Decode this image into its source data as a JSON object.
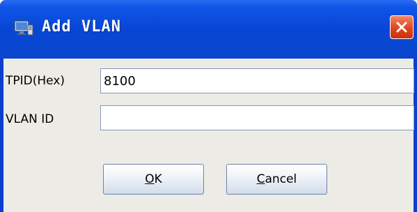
{
  "window": {
    "title": "Add VLAN",
    "icon": "computer-window-icon",
    "close_icon": "close-icon"
  },
  "form": {
    "tpid_label": "TPID(Hex)",
    "tpid_value": "8100",
    "vlan_id_label": "VLAN ID",
    "vlan_id_value": ""
  },
  "buttons": {
    "ok_mnemonic": "O",
    "ok_rest": "K",
    "cancel_mnemonic": "C",
    "cancel_rest": "ancel"
  },
  "colors": {
    "titlebar": "#0a45cc",
    "close_button": "#e0451c",
    "dialog_background": "#ecebe6"
  }
}
